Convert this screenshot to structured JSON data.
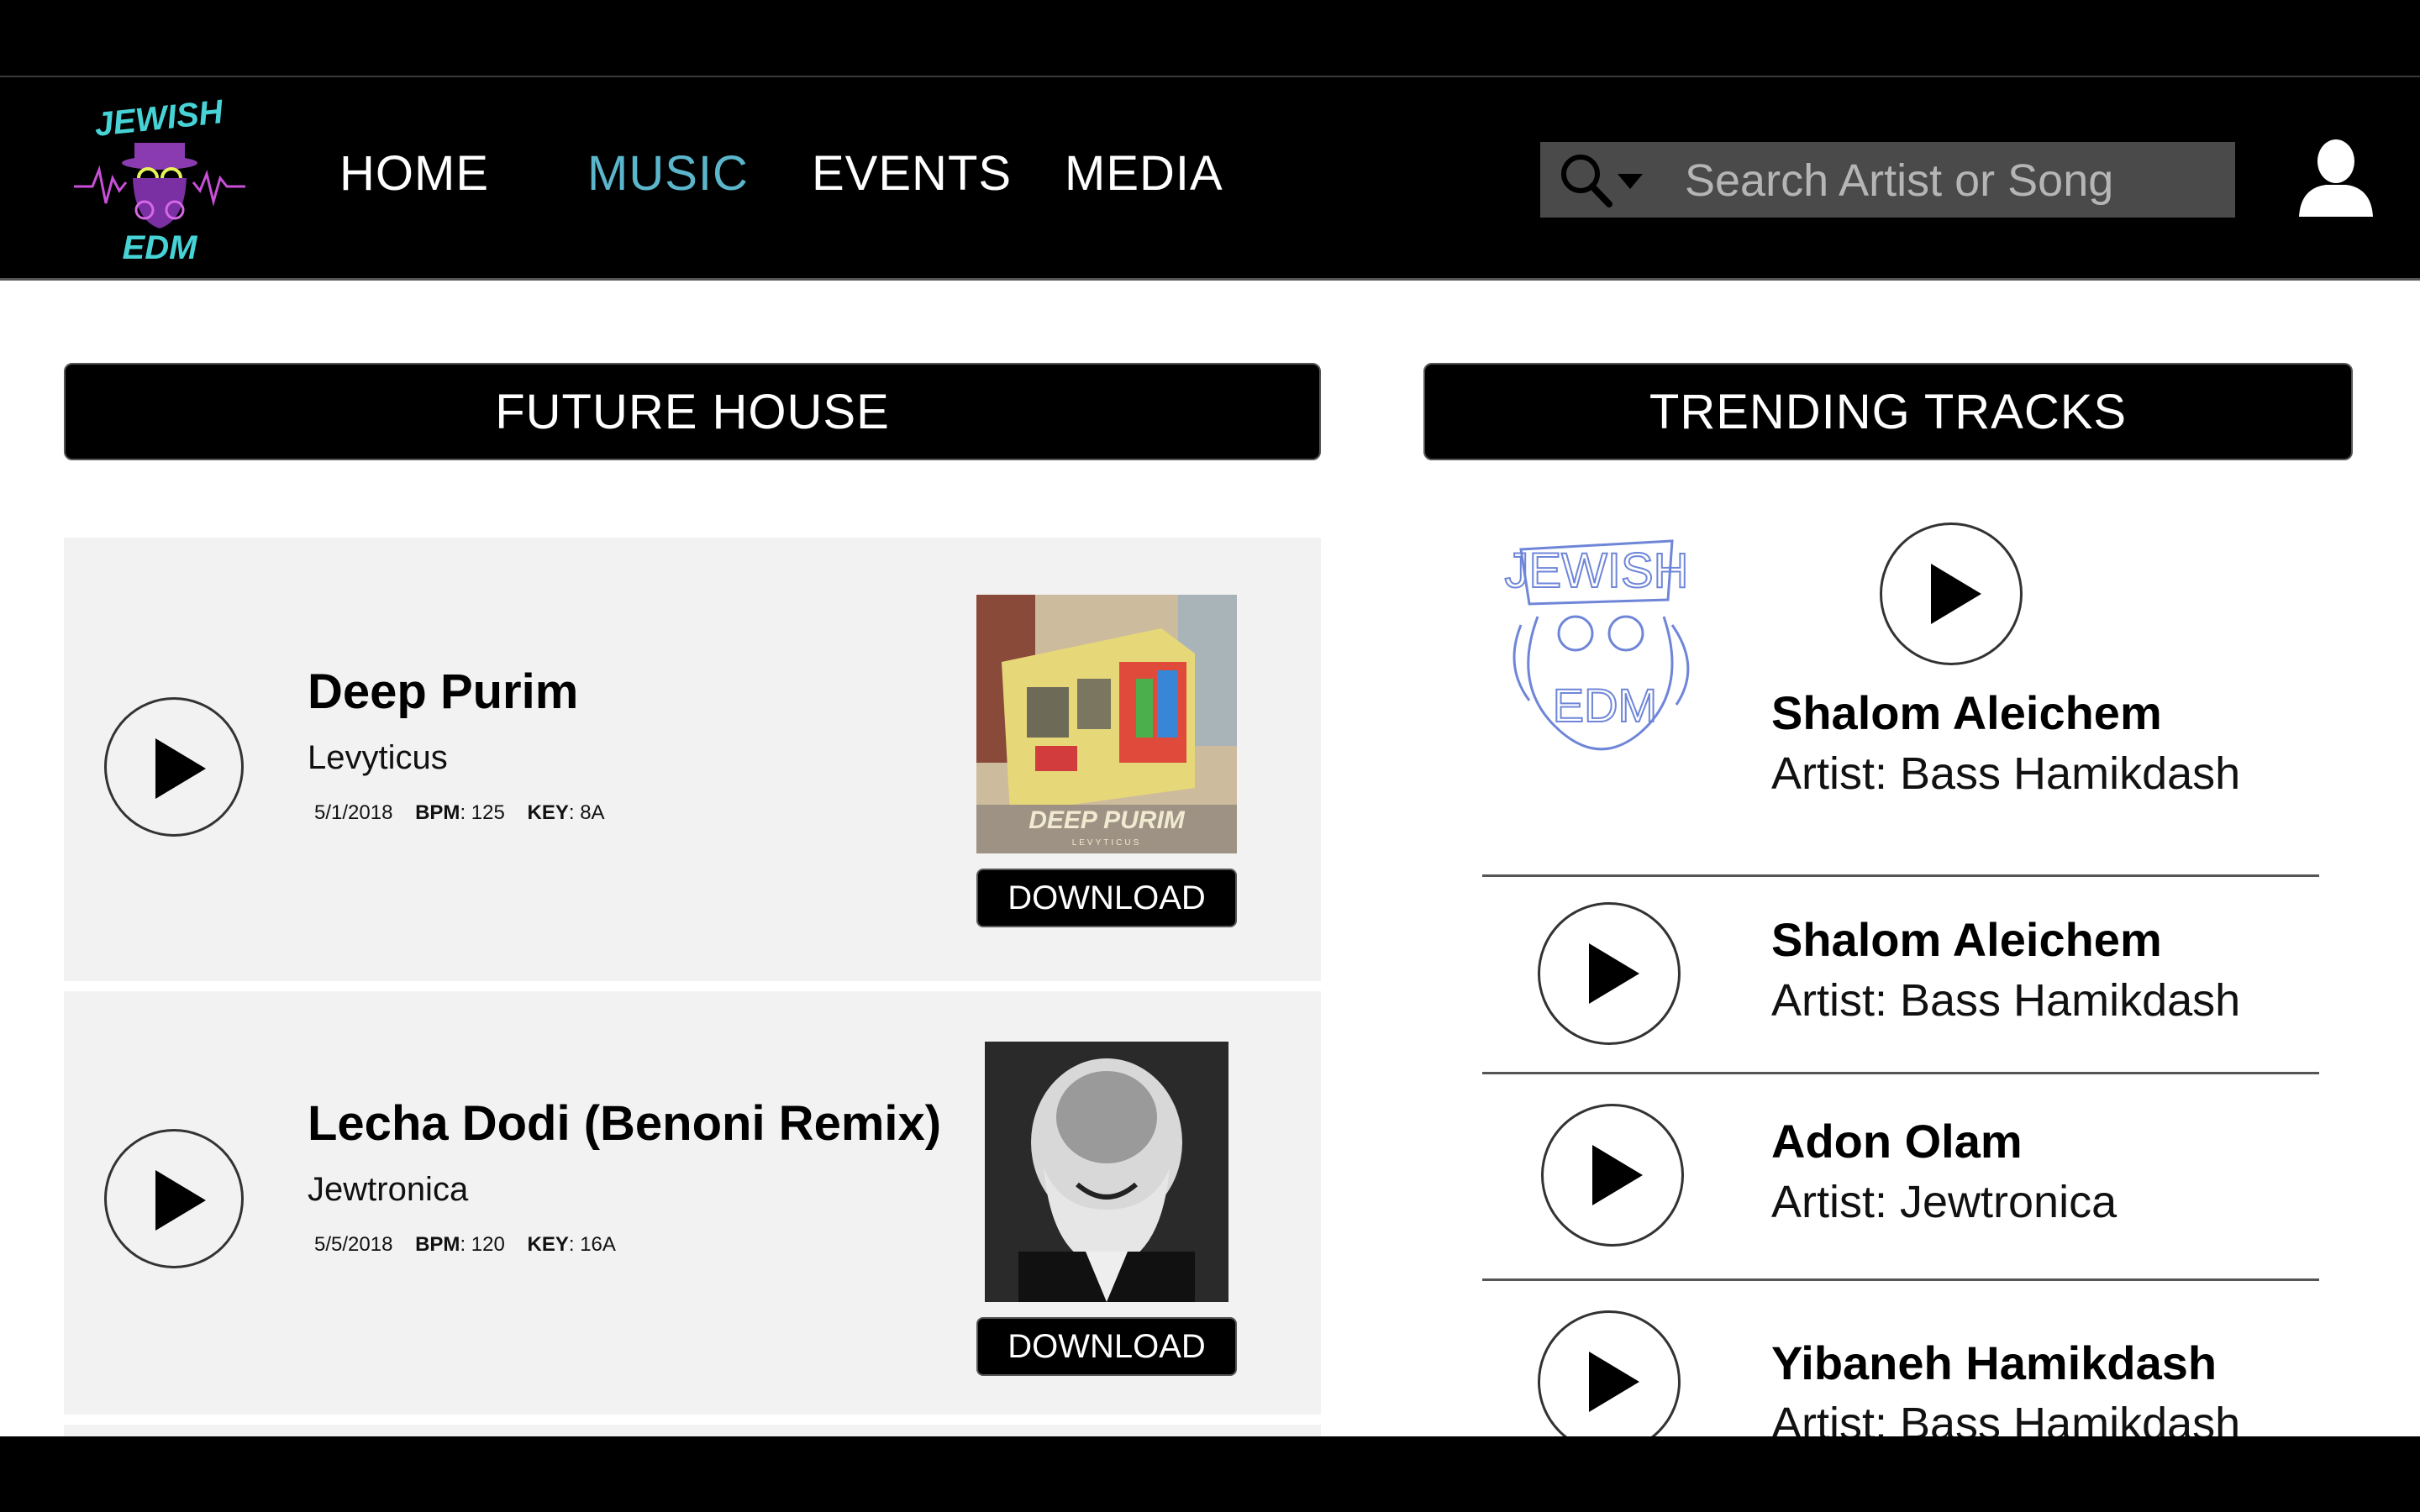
{
  "brand": {
    "logo_text_top": "JEWISH",
    "logo_text_bottom": "EDM"
  },
  "nav": {
    "items": [
      {
        "label": "HOME"
      },
      {
        "label": "MUSIC",
        "active": true
      },
      {
        "label": "EVENTS"
      },
      {
        "label": "MEDIA"
      }
    ]
  },
  "search": {
    "placeholder": "Search Artist or Song"
  },
  "colors": {
    "accent": "#5bb6cc",
    "header_bg": "#000000",
    "card_bg": "#f2f2f2",
    "search_bg": "#4a4a4a"
  },
  "genre": {
    "title": "FUTURE HOUSE",
    "tracks": [
      {
        "title": "Deep Purim",
        "artist": "Levyticus",
        "date": "5/1/2018",
        "bpm_label": "BPM",
        "bpm": "125",
        "key_label": "KEY",
        "key": "8A",
        "art_text": "DEEP PURIM",
        "art_subtext": "LEVYTICUS",
        "download_label": "DOWNLOAD"
      },
      {
        "title": "Lecha Dodi (Benoni Remix)",
        "artist": "Jewtronica",
        "date": "5/5/2018",
        "bpm_label": "BPM",
        "bpm": "120",
        "key_label": "KEY",
        "key": "16A",
        "download_label": "DOWNLOAD"
      }
    ]
  },
  "trending": {
    "title": "TRENDING TRACKS",
    "featured": {
      "title": "Shalom Aleichem",
      "artist": "Artist: Bass Hamikdash",
      "sketch_text_top": "JEWISH",
      "sketch_text_bottom": "EDM"
    },
    "items": [
      {
        "title": "Shalom Aleichem",
        "artist": "Artist: Bass Hamikdash"
      },
      {
        "title": "Adon Olam",
        "artist": "Artist: Jewtronica"
      },
      {
        "title": "Yibaneh Hamikdash",
        "artist": "Artist: Bass Hamikdash"
      }
    ]
  }
}
